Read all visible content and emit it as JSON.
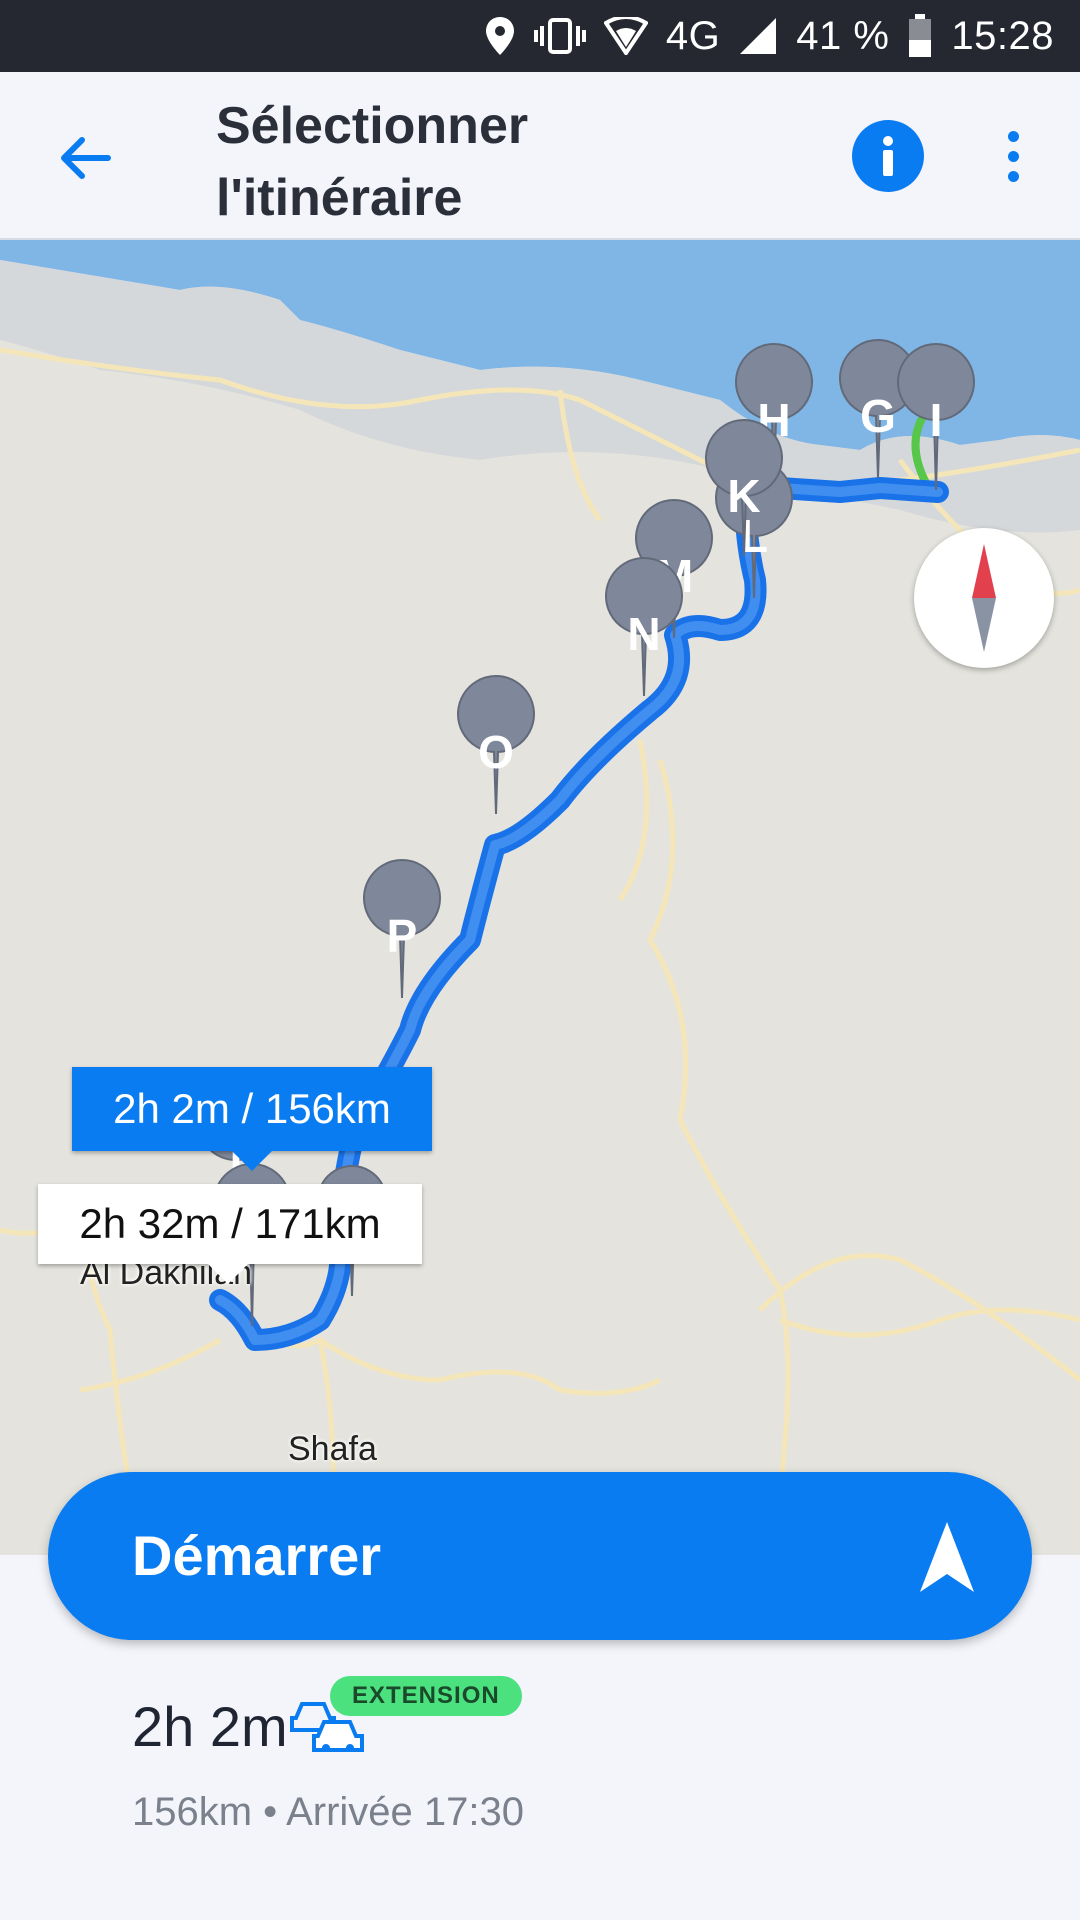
{
  "status_bar": {
    "battery": "41 %",
    "time": "15:28",
    "network": "4G",
    "icons": [
      "location-icon",
      "vibrate-icon",
      "wifi-icon",
      "signal-icon",
      "battery-icon"
    ]
  },
  "header": {
    "title_line1": "Sélectionner",
    "title_line2": "l'itinéraire",
    "back_icon": "arrow-left-icon",
    "info_icon": "info-icon",
    "more_icon": "more-vert-icon"
  },
  "map": {
    "waypoints": [
      "H",
      "G",
      "I",
      "K",
      "L",
      "M",
      "N",
      "O",
      "P",
      "T",
      "R"
    ],
    "towns": [
      "Al Dakhilah",
      "Shafa"
    ],
    "route_labels": {
      "selected": "2h 2m / 156km",
      "alternative": "2h 32m / 171km"
    }
  },
  "start_button": {
    "label": "Démarrer",
    "icon": "navigation-arrow-icon"
  },
  "route_summary": {
    "duration": "2h 2m",
    "badge": "EXTENSION",
    "meta": "156km • Arrivée 17:30",
    "icon": "traffic-cars-icon"
  },
  "colors": {
    "accent": "#0a7cf2",
    "status_bar": "#252830",
    "badge": "#4be17f",
    "sea": "#80b6e6",
    "land": "#e4e3dd"
  }
}
